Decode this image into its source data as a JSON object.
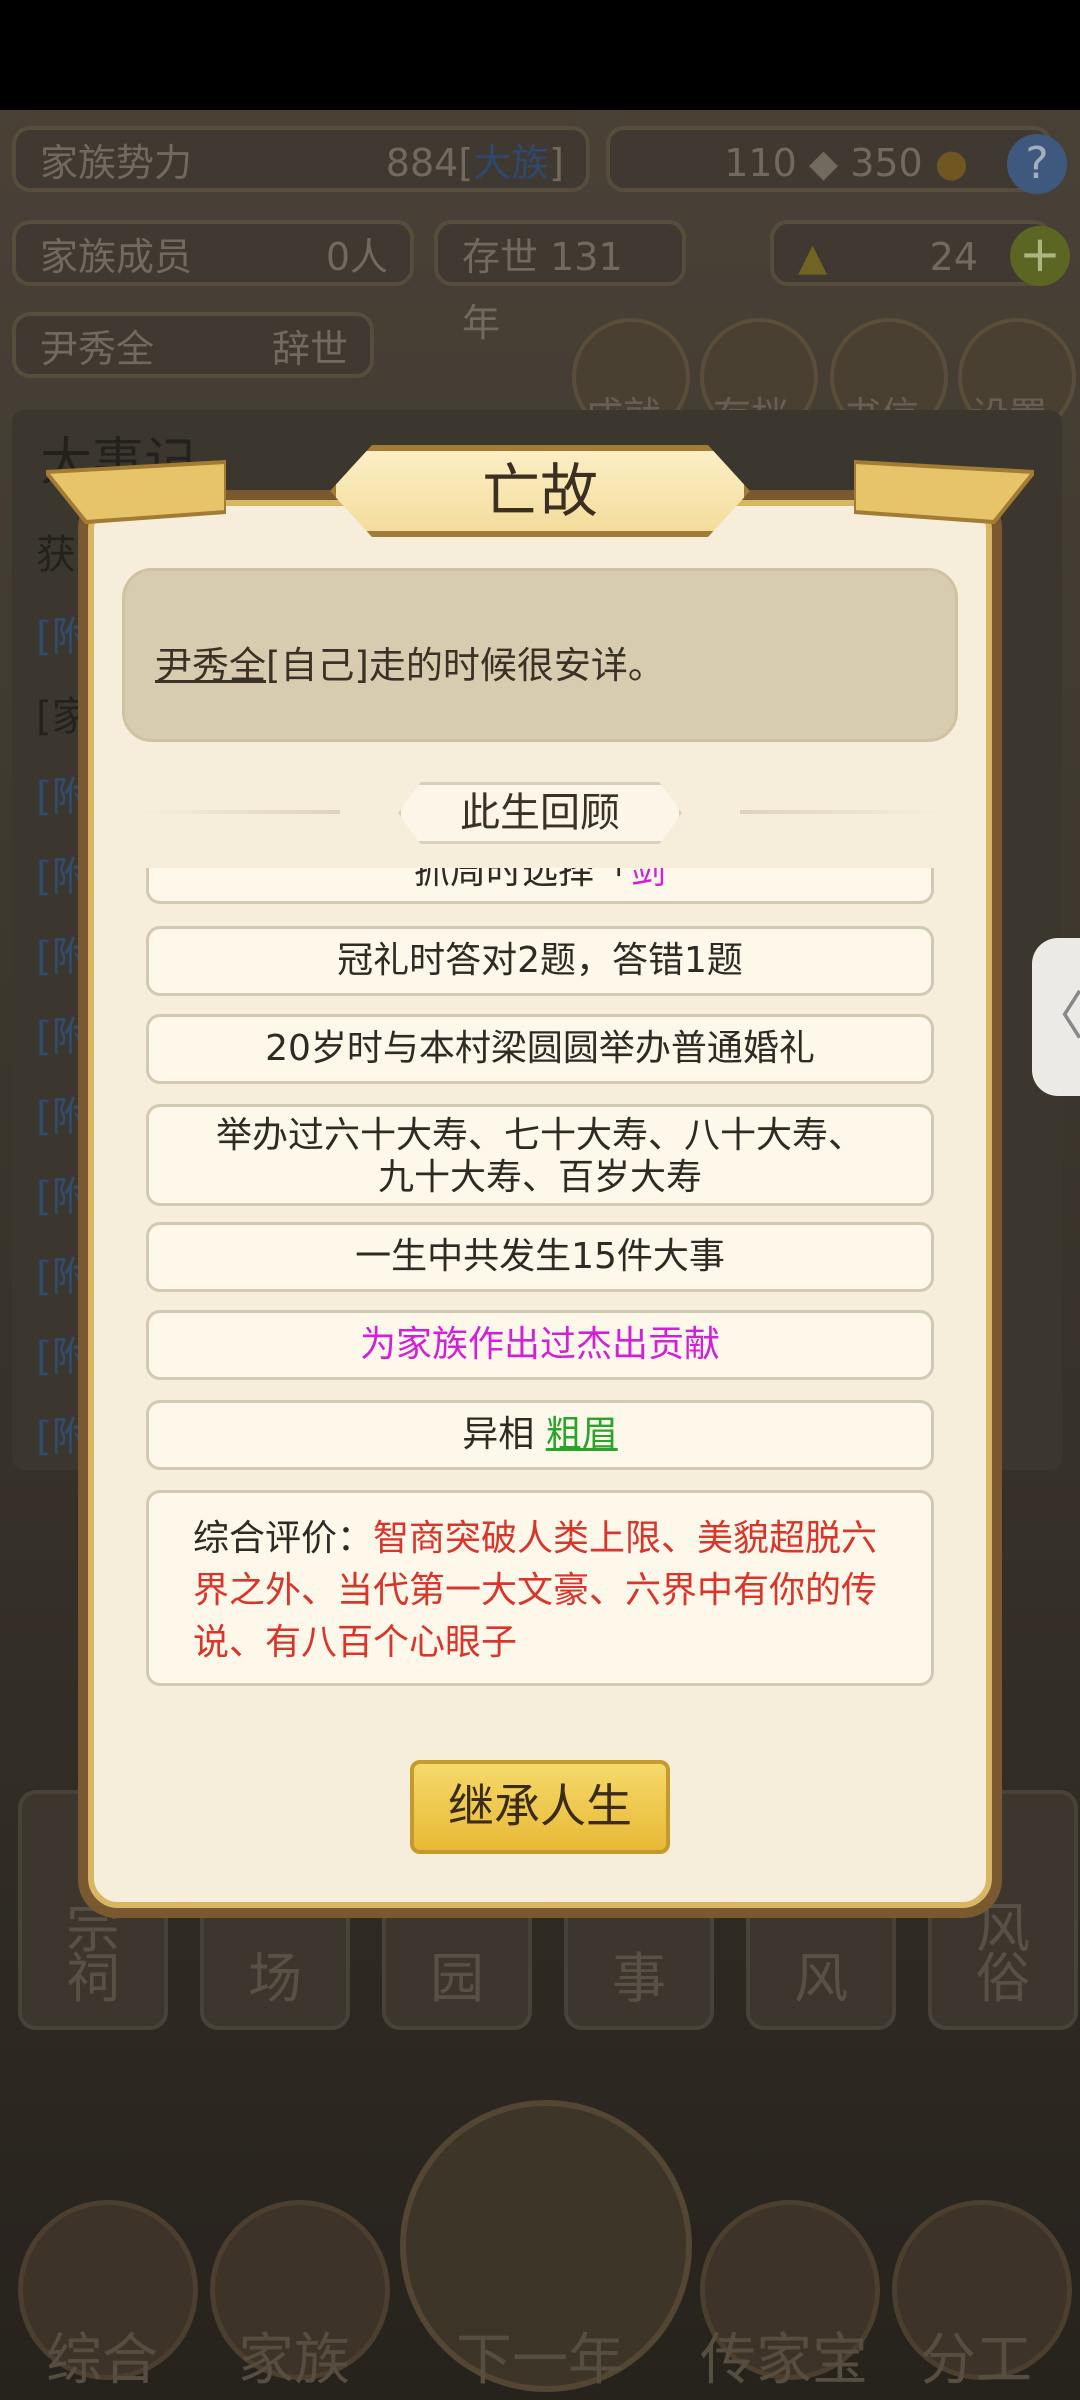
{
  "header": {
    "family_power_label": "家族势力",
    "family_power_value": "884",
    "bracket_open": "[",
    "family_power_rank": "大族",
    "bracket_close": "]",
    "currency_a": "110",
    "currency_b": "350",
    "help_icon": "?",
    "members_label": "家族成员",
    "members_value": "0人",
    "exist_label": "存世",
    "exist_value": "131年",
    "gold_value": "24",
    "plus_icon": "+",
    "person_name": "尹秀全",
    "person_status": "辞世"
  },
  "top_icons": [
    {
      "label": "成就",
      "icon": "achievement-icon"
    },
    {
      "label": "存档",
      "icon": "save-icon"
    },
    {
      "label": "书信",
      "icon": "letter-icon"
    },
    {
      "label": "设置",
      "icon": "settings-icon"
    }
  ],
  "background_panel": {
    "title": "大事记",
    "rows": [
      "获",
      "[附",
      "[家",
      "[附",
      "[附",
      "[附",
      "[附",
      "[附",
      "[附",
      "[附",
      "[附",
      "[附"
    ]
  },
  "tiles": [
    "祠",
    "场",
    "园",
    "事",
    "风",
    "俗"
  ],
  "tile_top": [
    "宗",
    "",
    "",
    "",
    "",
    "风"
  ],
  "bottom_nav": [
    {
      "label": "综合"
    },
    {
      "label": "家族"
    },
    {
      "label": "下一年"
    },
    {
      "label": "传家宝"
    },
    {
      "label": "分工"
    }
  ],
  "side_tab": "〈",
  "modal": {
    "title": "亡故",
    "notice_name": "尹秀全",
    "notice_rest": "[自己]走的时候很安详。",
    "section_title": "此生回顾",
    "partial_item_text": "抓周时选择「",
    "partial_item_highlight": "剑",
    "items": [
      "冠礼时答对2题，答错1题",
      "20岁时与本村梁圆圆举办普通婚礼",
      "举办过六十大寿、七十大寿、八十大寿、",
      "九十大寿、百岁大寿",
      "一生中共发生15件大事",
      "为家族作出过杰出贡献"
    ],
    "trait_label": "异相",
    "trait_value": "粗眉",
    "evaluation_label": "综合评价：",
    "evaluation_text": "智商突破人类上限、美貌超脱六界之外、当代第一大文豪、六界中有你的传说、有八百个心眼子",
    "button_label": "继承人生"
  },
  "colors": {
    "modal_bg": "#f6eeda",
    "modal_border": "#d9b664",
    "magenta": "#d41fd8",
    "green_link": "#2aa42a",
    "eval_red": "#d9352b",
    "button_gold": "#e7b936"
  }
}
